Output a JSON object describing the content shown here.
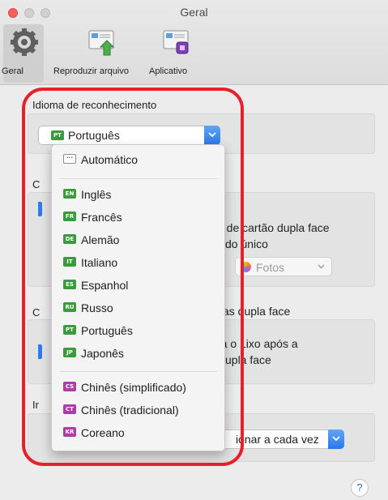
{
  "window": {
    "title": "Geral"
  },
  "toolbar": {
    "items": [
      {
        "label": "Geral",
        "icon": "gear-icon"
      },
      {
        "label": "Reproduzir arquivo",
        "icon": "scan-to-file-icon"
      },
      {
        "label": "Aplicativo",
        "icon": "scan-to-app-icon"
      }
    ]
  },
  "recognition": {
    "group_label": "Idioma de reconhecimento",
    "selected": {
      "code": "PT",
      "label": "Português"
    }
  },
  "background_fragments": {
    "c1": "C",
    "c2": "C",
    "i1": "Ir",
    "line1": "o de cartão dupla face",
    "line2": "do único",
    "line3": "itas dupla face",
    "line4": "ra o Lixo após a",
    "line5": "upla face",
    "fotos_label": "Fotos",
    "select2_label": "ionar a cada vez"
  },
  "language_menu": {
    "auto": {
      "code": "···",
      "label": "Automático"
    },
    "group1": [
      {
        "code": "EN",
        "label": "Inglês"
      },
      {
        "code": "FR",
        "label": "Francês"
      },
      {
        "code": "DE",
        "label": "Alemão"
      },
      {
        "code": "IT",
        "label": "Italiano"
      },
      {
        "code": "ES",
        "label": "Espanhol"
      },
      {
        "code": "RU",
        "label": "Russo"
      },
      {
        "code": "PT",
        "label": "Português"
      },
      {
        "code": "JP",
        "label": "Japonês"
      }
    ],
    "group2": [
      {
        "code": "CS",
        "label": "Chinês (simplificado)"
      },
      {
        "code": "CT",
        "label": "Chinês (tradicional)"
      },
      {
        "code": "KR",
        "label": "Coreano"
      }
    ]
  },
  "help": {
    "label": "?"
  },
  "colors": {
    "accent": "#2f7bf0",
    "highlight": "#e8202a",
    "flag_green": "#3a9a3c",
    "flag_purple": "#b03aa6",
    "close": "#fc605c"
  }
}
